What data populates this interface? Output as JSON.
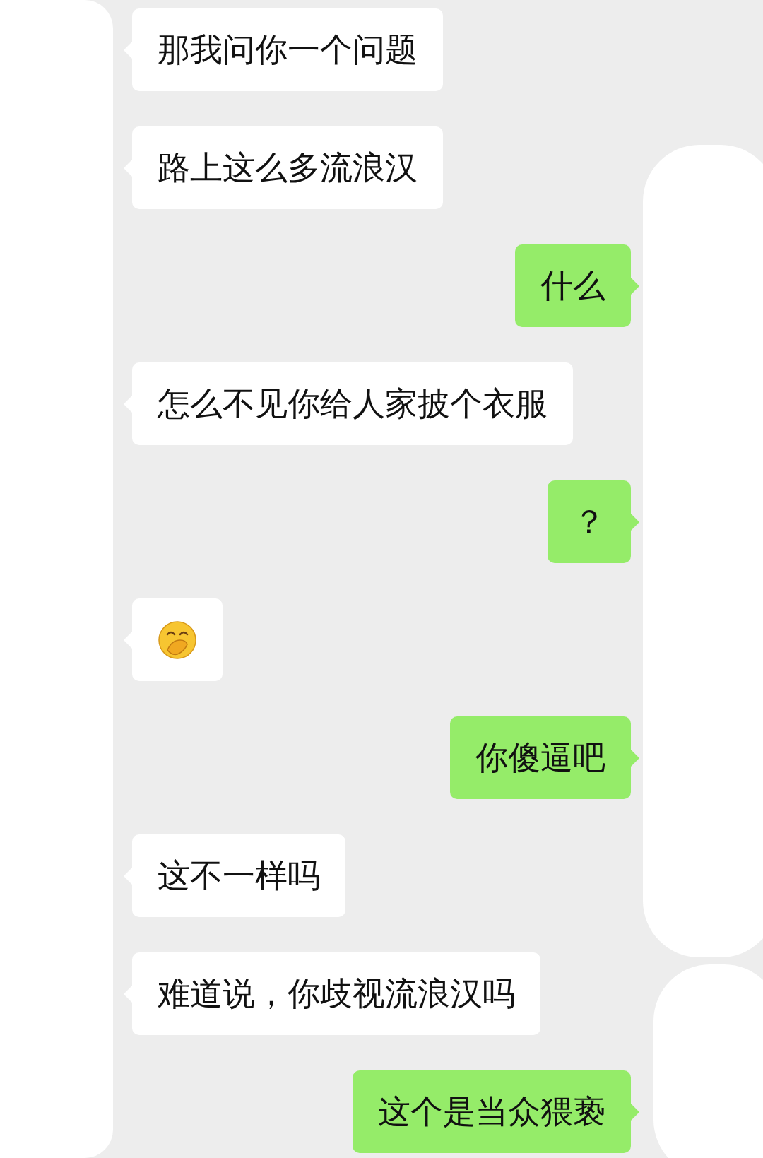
{
  "messages": [
    {
      "kind": "text",
      "outgoing": false,
      "text": "那我问你一个问题"
    },
    {
      "kind": "text",
      "outgoing": false,
      "text": "路上这么多流浪汉"
    },
    {
      "kind": "text",
      "outgoing": true,
      "text": "什么"
    },
    {
      "kind": "text",
      "outgoing": false,
      "text": "怎么不见你给人家披个衣服"
    },
    {
      "kind": "text",
      "outgoing": true,
      "text": "？"
    },
    {
      "kind": "emoji",
      "outgoing": false
    },
    {
      "kind": "text",
      "outgoing": true,
      "text": "你傻逼吧"
    },
    {
      "kind": "text",
      "outgoing": false,
      "text": "这不一样吗"
    },
    {
      "kind": "text",
      "outgoing": false,
      "text": "难道说，你歧视流浪汉吗"
    },
    {
      "kind": "text",
      "outgoing": true,
      "text": "这个是当众猥亵"
    }
  ]
}
